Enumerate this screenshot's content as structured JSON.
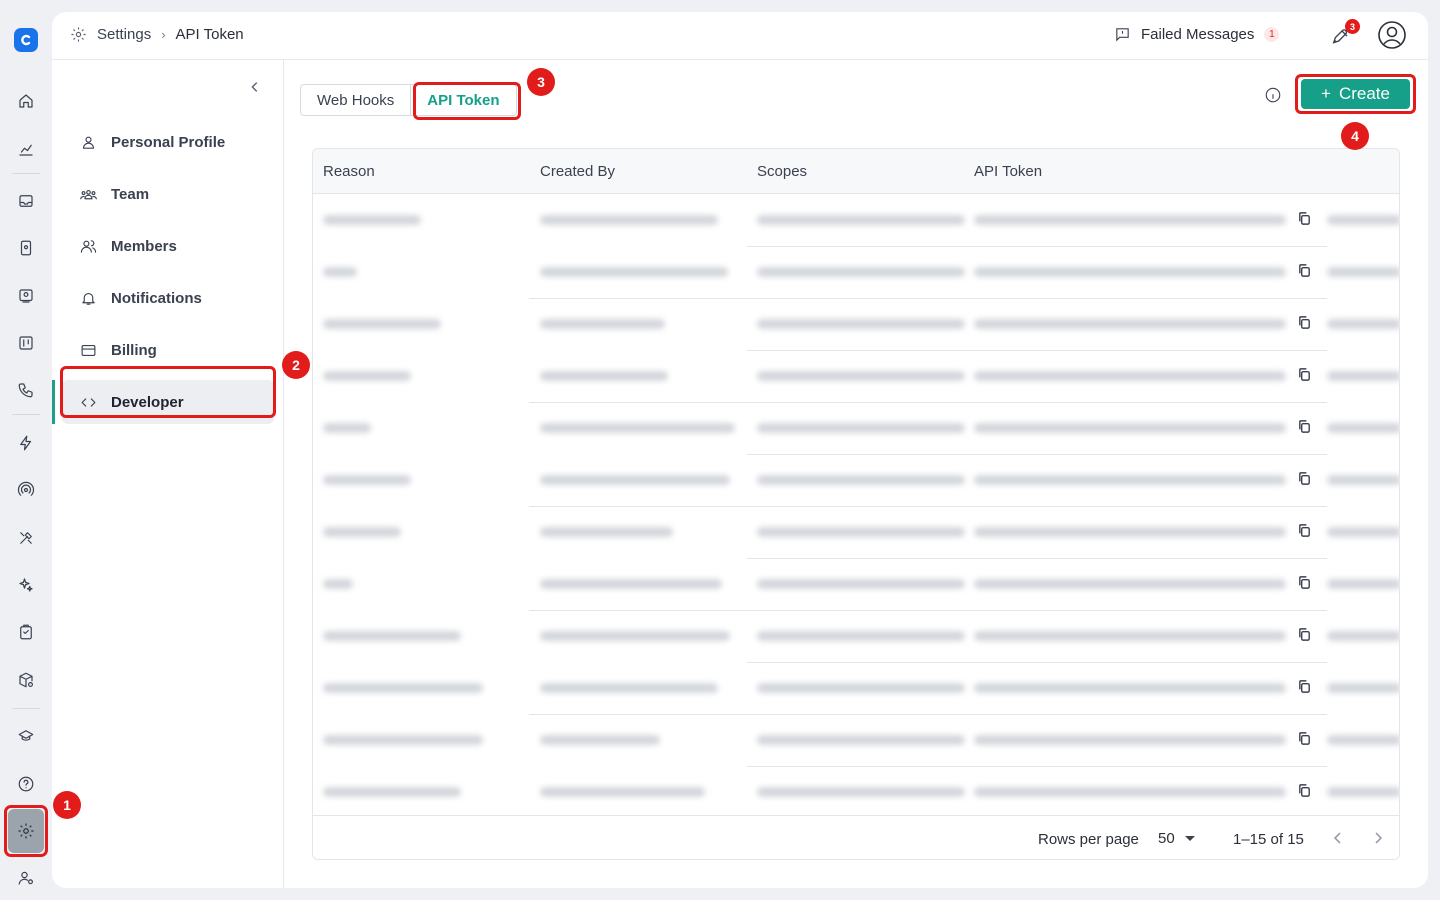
{
  "breadcrumb": {
    "root": "Settings",
    "current": "API Token"
  },
  "topbar": {
    "failed_label": "Failed Messages",
    "failed_count": "1",
    "notif_count": "3"
  },
  "sidenav": {
    "items": [
      {
        "label": "Personal Profile",
        "icon": "person-icon"
      },
      {
        "label": "Team",
        "icon": "team-icon"
      },
      {
        "label": "Members",
        "icon": "members-icon"
      },
      {
        "label": "Notifications",
        "icon": "bell-icon"
      },
      {
        "label": "Billing",
        "icon": "card-icon"
      },
      {
        "label": "Developer",
        "icon": "code-icon"
      }
    ]
  },
  "tabs": {
    "webhooks": "Web Hooks",
    "api_token": "API Token"
  },
  "create": {
    "label": "Create",
    "plus": "+"
  },
  "table": {
    "columns": [
      "Reason",
      "Created By",
      "Scopes",
      "API Token"
    ]
  },
  "footer": {
    "rows_per_page_label": "Rows per page",
    "rows_per_page": "50",
    "range": "1–15 of 15"
  },
  "markers": [
    "1",
    "2",
    "3",
    "4"
  ],
  "colors": {
    "accent": "#16a089",
    "highlight": "#e21b1b",
    "logo": "#1a73e8"
  }
}
